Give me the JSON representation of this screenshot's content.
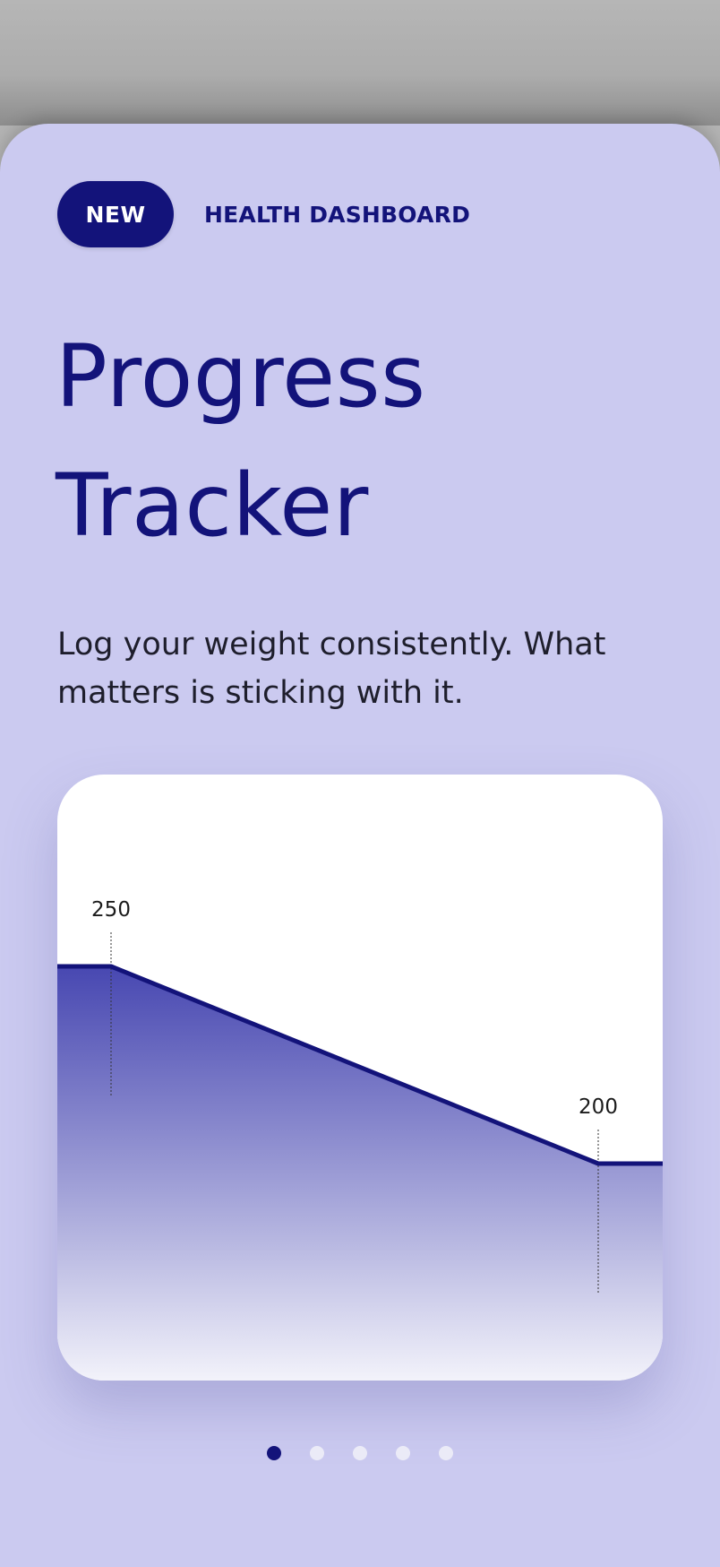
{
  "header": {
    "badge_label": "NEW",
    "category_label": "HEALTH DASHBOARD"
  },
  "hero": {
    "title": "Progress Tracker",
    "subtitle": "Log your weight consistently. What matters is sticking with it."
  },
  "chart_data": {
    "type": "area",
    "title": "",
    "xlabel": "",
    "ylabel": "",
    "points": [
      {
        "label": "250",
        "value": 250
      },
      {
        "label": "200",
        "value": 200
      }
    ],
    "colors": {
      "line": "#13137a",
      "fill_top": "#3e3ead",
      "fill_bottom": "#f4f4fb"
    },
    "grid": false,
    "legend": "none"
  },
  "pager": {
    "count": 5,
    "active_index": 0
  },
  "colors": {
    "accent": "#13137a",
    "background": "#cbcaf0",
    "card": "#ffffff"
  }
}
